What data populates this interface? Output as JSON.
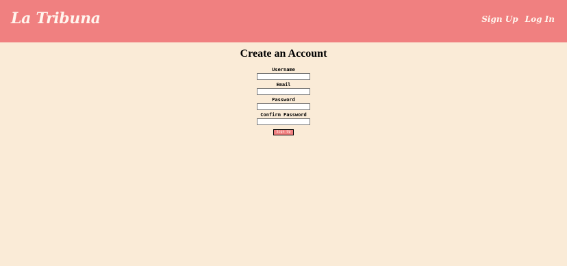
{
  "header": {
    "brand": "La Tribuna",
    "nav": [
      {
        "label": "Sign Up"
      },
      {
        "label": "Log In"
      }
    ]
  },
  "main": {
    "title": "Create an Account",
    "fields": [
      {
        "label": "Username",
        "value": ""
      },
      {
        "label": "Email",
        "value": ""
      },
      {
        "label": "Password",
        "value": ""
      },
      {
        "label": "Confirm Password",
        "value": ""
      }
    ],
    "submit_label": "Sign Up"
  },
  "colors": {
    "header_bg": "#f08080",
    "page_bg": "#faebd7",
    "header_text": "#fff5ee"
  }
}
